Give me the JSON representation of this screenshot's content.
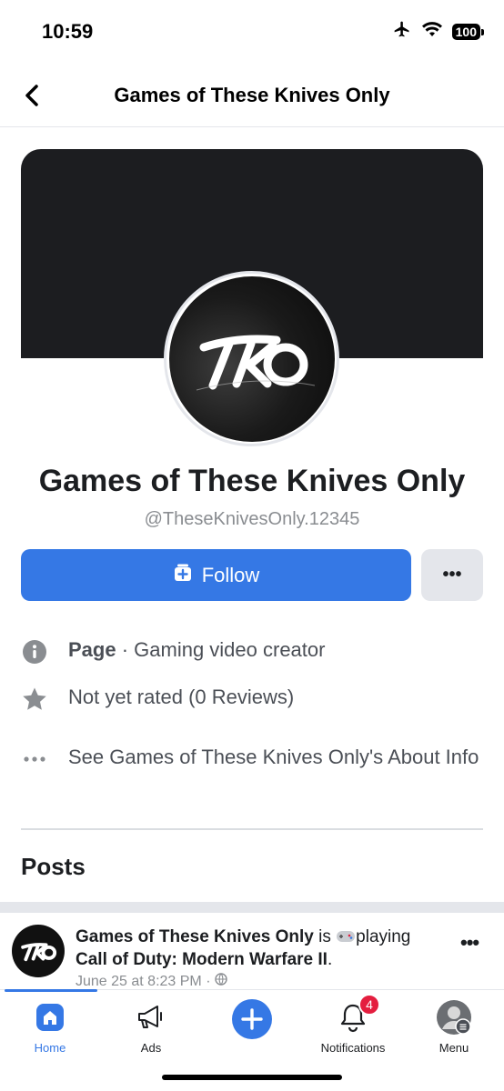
{
  "status_bar": {
    "time": "10:59",
    "battery": "100"
  },
  "header": {
    "title": "Games of These Knives Only"
  },
  "profile": {
    "logo_text": "TKO",
    "name": "Games of These Knives Only",
    "handle": "@TheseKnivesOnly.12345",
    "follow_label": "Follow",
    "more_label": "•••"
  },
  "info": {
    "category_bold": "Page",
    "category_rest": " · Gaming video creator",
    "rating": "Not yet rated (0 Reviews)",
    "about": "See Games of These Knives Only's About Info"
  },
  "posts": {
    "heading": "Posts",
    "items": [
      {
        "author": "Games of These Knives Only",
        "verb_is": " is ",
        "activity": "playing",
        "game": "Call of Duty: Modern Warfare II",
        "game_suffix": ".",
        "timestamp": "June 25 at 8:23 PM ·",
        "more_label": "•••"
      }
    ]
  },
  "tabs": [
    {
      "label": "Home",
      "icon": "home-icon",
      "active": true
    },
    {
      "label": "Ads",
      "icon": "megaphone-icon"
    },
    {
      "label": "",
      "icon": "create-plus-icon"
    },
    {
      "label": "Notifications",
      "icon": "bell-icon",
      "badge": "4"
    },
    {
      "label": "Menu",
      "icon": "profile-menu-icon"
    }
  ],
  "colors": {
    "accent": "#3578e5",
    "badge": "#e41e3f",
    "cover": "#1c1d20"
  }
}
